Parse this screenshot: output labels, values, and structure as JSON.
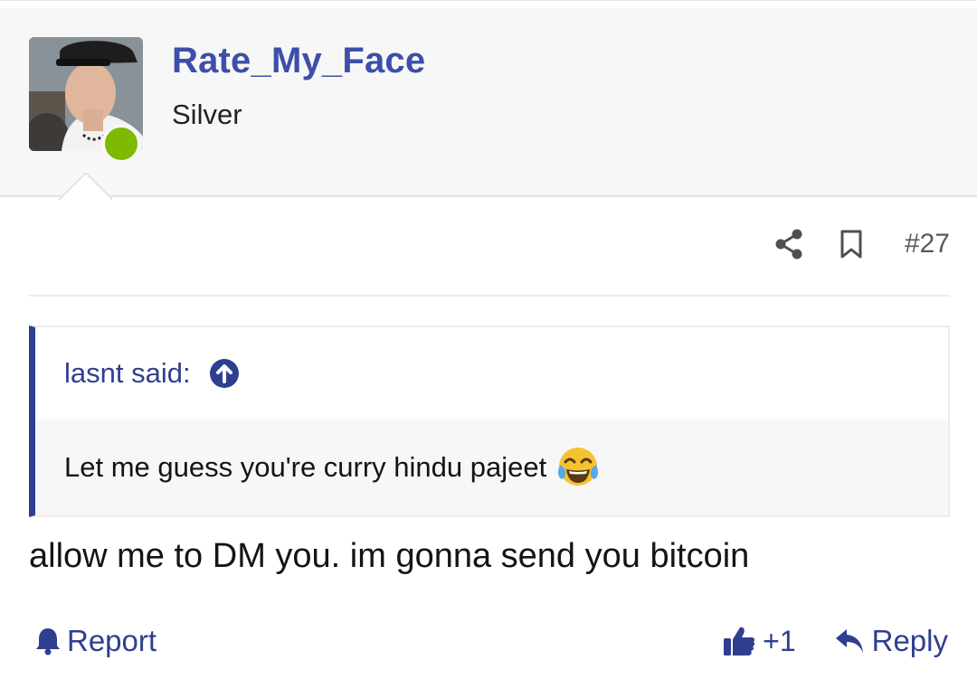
{
  "user": {
    "name": "Rate_My_Face",
    "title": "Silver",
    "avatar_icon": "user-photo",
    "online": true,
    "online_color": "#7fba00"
  },
  "post": {
    "number": "#27",
    "share_icon": "share-icon",
    "bookmark_icon": "bookmark-icon"
  },
  "quote": {
    "attribution": "lasnt said:",
    "arrow_icon": "arrow-up-circle-icon",
    "text": "Let me guess you're curry hindu pajeet",
    "emoji_icon": "tears-of-joy-emoji"
  },
  "message": "allow me to DM you. im gonna send you bitcoin",
  "footer": {
    "report_label": "Report",
    "like_count": "+1",
    "reply_label": "Reply"
  },
  "colors": {
    "accent": "#3d4fa8",
    "link": "#2f3f8f",
    "header_bg": "#f7f7f7"
  }
}
